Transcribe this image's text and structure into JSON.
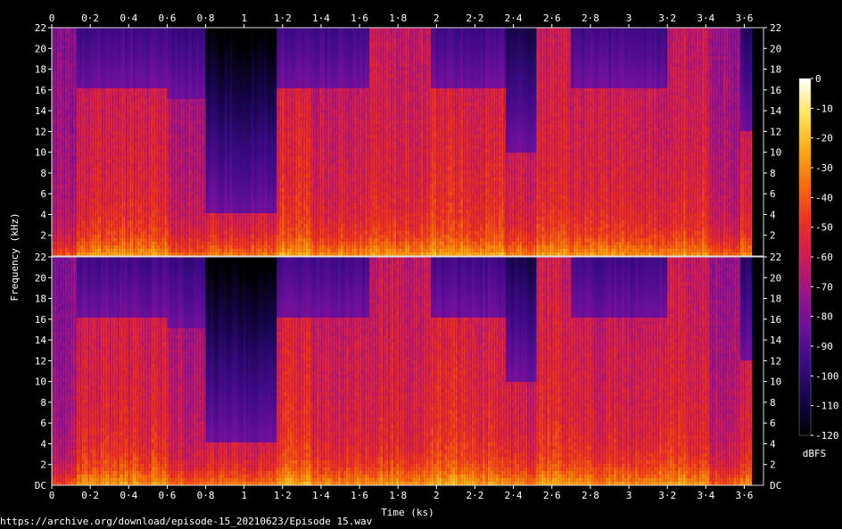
{
  "source_url": "https://archive.org/download/episode-15_20210623/Episode 15.wav",
  "chart_data": {
    "type": "heatmap",
    "title": "",
    "xlabel": "Time (ks)",
    "ylabel": "Frequency (kHz)",
    "xlim": [
      0,
      3.7
    ],
    "ylim": [
      0,
      22
    ],
    "x_ticks": [
      {
        "v": 0,
        "label": "0"
      },
      {
        "v": 0.2,
        "label": "0·2"
      },
      {
        "v": 0.4,
        "label": "0·4"
      },
      {
        "v": 0.6,
        "label": "0·6"
      },
      {
        "v": 0.8,
        "label": "0·8"
      },
      {
        "v": 1,
        "label": "1"
      },
      {
        "v": 1.2,
        "label": "1·2"
      },
      {
        "v": 1.4,
        "label": "1·4"
      },
      {
        "v": 1.6,
        "label": "1·6"
      },
      {
        "v": 1.8,
        "label": "1·8"
      },
      {
        "v": 2,
        "label": "2"
      },
      {
        "v": 2.2,
        "label": "2·2"
      },
      {
        "v": 2.4,
        "label": "2·4"
      },
      {
        "v": 2.6,
        "label": "2·6"
      },
      {
        "v": 2.8,
        "label": "2·8"
      },
      {
        "v": 3,
        "label": "3"
      },
      {
        "v": 3.2,
        "label": "3·2"
      },
      {
        "v": 3.4,
        "label": "3·4"
      },
      {
        "v": 3.6,
        "label": "3·6"
      }
    ],
    "y_ticks": [
      {
        "v": 22,
        "label": "22"
      },
      {
        "v": 20,
        "label": "20"
      },
      {
        "v": 18,
        "label": "18"
      },
      {
        "v": 16,
        "label": "16"
      },
      {
        "v": 14,
        "label": "14"
      },
      {
        "v": 12,
        "label": "12"
      },
      {
        "v": 10,
        "label": "10"
      },
      {
        "v": 8,
        "label": "8"
      },
      {
        "v": 6,
        "label": "6"
      },
      {
        "v": 4,
        "label": "4"
      },
      {
        "v": 2,
        "label": "2"
      }
    ],
    "y_bottom_label_top": "22",
    "y_bottom_label_bottom": "DC",
    "channels": 2,
    "colorbar": {
      "label": "dBFS",
      "range": [
        -120,
        0
      ],
      "ticks": [
        0,
        -10,
        -20,
        -30,
        -40,
        -50,
        -60,
        -70,
        -80,
        -90,
        -100,
        -110,
        -120
      ],
      "tick_labels": [
        "0",
        "-10",
        "-20",
        "-30",
        "-40",
        "-50",
        "-60",
        "-70",
        "-80",
        "-90",
        "-100",
        "-110",
        "-120"
      ],
      "colors": [
        "#000000",
        "#16054a",
        "#3a0a82",
        "#6a0f9a",
        "#9c1288",
        "#cf1a55",
        "#ee2f20",
        "#fb6a0a",
        "#ffaa10",
        "#ffe35a",
        "#ffffff"
      ]
    },
    "segments": [
      {
        "x0": 0.0,
        "x1": 0.13,
        "cutoff": 22,
        "level": -65
      },
      {
        "x0": 0.13,
        "x1": 0.6,
        "cutoff": 16,
        "level": -50
      },
      {
        "x0": 0.6,
        "x1": 0.8,
        "cutoff": 15,
        "level": -60
      },
      {
        "x0": 0.8,
        "x1": 1.17,
        "cutoff": 4,
        "level": -57
      },
      {
        "x0": 1.17,
        "x1": 1.35,
        "cutoff": 16,
        "level": -48
      },
      {
        "x0": 1.35,
        "x1": 1.65,
        "cutoff": 16,
        "level": -54
      },
      {
        "x0": 1.65,
        "x1": 1.82,
        "cutoff": 22,
        "level": -50
      },
      {
        "x0": 1.82,
        "x1": 1.97,
        "cutoff": 22,
        "level": -52
      },
      {
        "x0": 1.97,
        "x1": 2.17,
        "cutoff": 16,
        "level": -47
      },
      {
        "x0": 2.17,
        "x1": 2.36,
        "cutoff": 16,
        "level": -49
      },
      {
        "x0": 2.36,
        "x1": 2.52,
        "cutoff": 10,
        "level": -55
      },
      {
        "x0": 2.52,
        "x1": 2.7,
        "cutoff": 22,
        "level": -48
      },
      {
        "x0": 2.7,
        "x1": 3.2,
        "cutoff": 16,
        "level": -52
      },
      {
        "x0": 3.2,
        "x1": 3.42,
        "cutoff": 22,
        "level": -50
      },
      {
        "x0": 3.42,
        "x1": 3.58,
        "cutoff": 22,
        "level": -62
      },
      {
        "x0": 3.58,
        "x1": 3.64,
        "cutoff": 12,
        "level": -52
      },
      {
        "x0": 3.64,
        "x1": 3.7,
        "cutoff": 0,
        "level": -120
      }
    ]
  }
}
